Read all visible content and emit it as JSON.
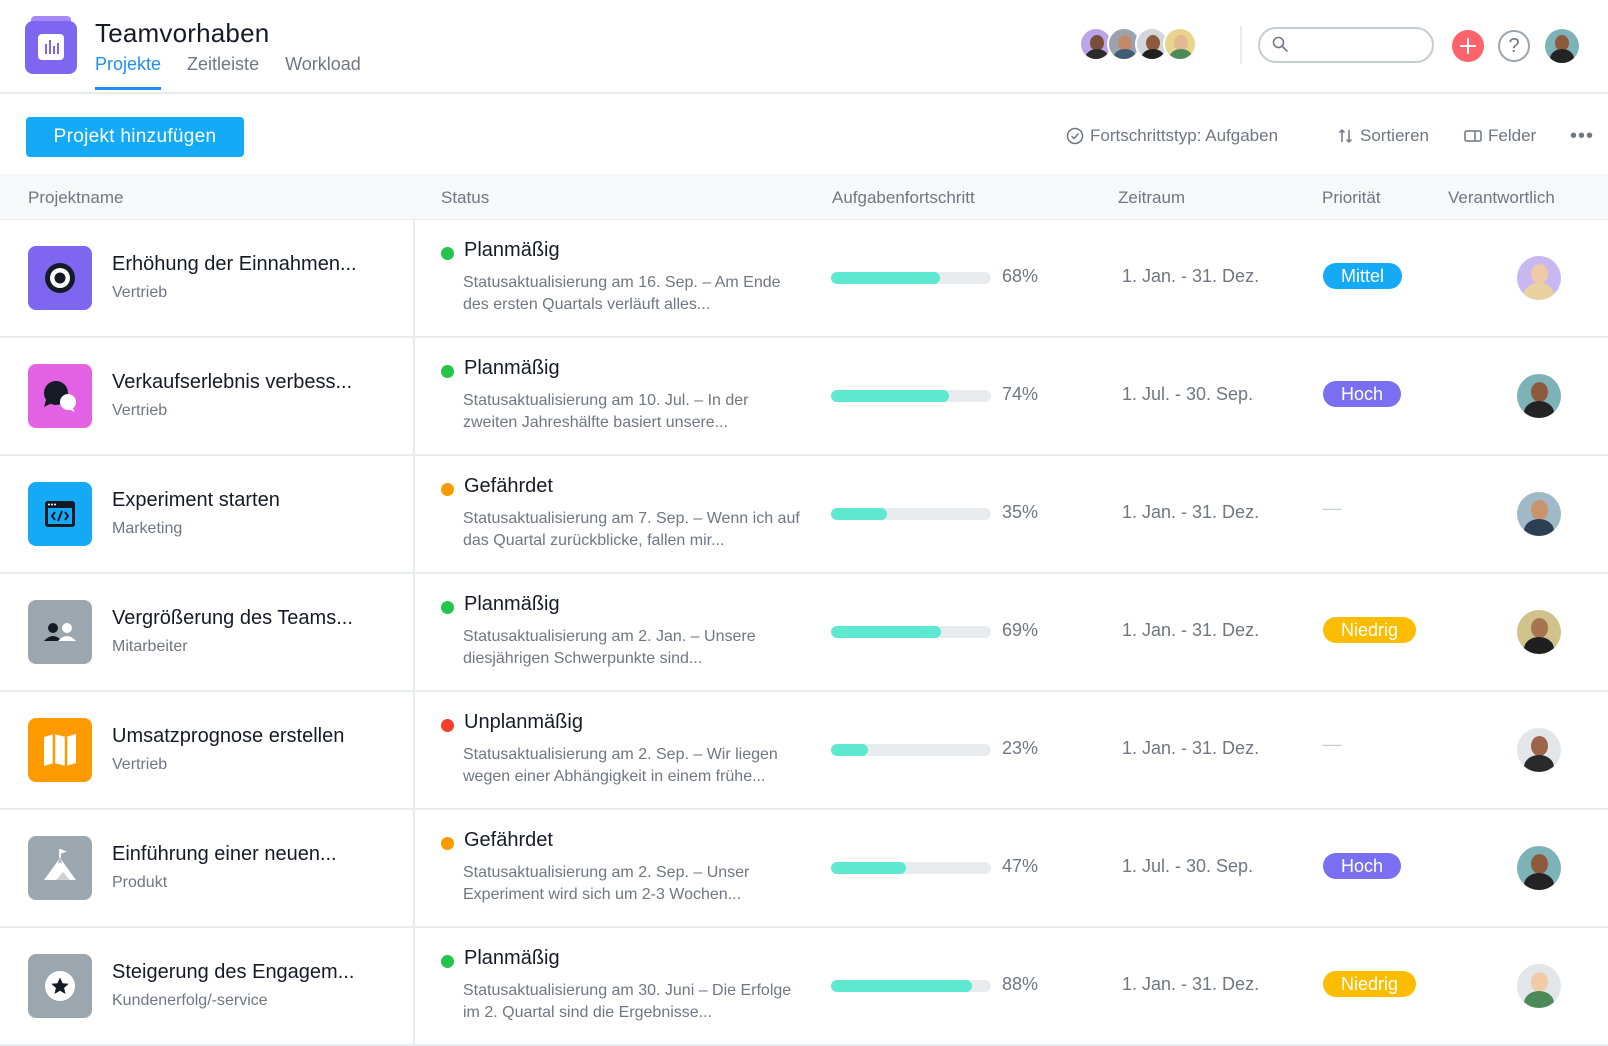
{
  "header": {
    "title": "Teamvorhaben",
    "tabs": [
      {
        "label": "Projekte",
        "active": true
      },
      {
        "label": "Zeitleiste",
        "active": false
      },
      {
        "label": "Workload",
        "active": false
      }
    ],
    "search": {
      "placeholder": "",
      "value": ""
    },
    "help_label": "?"
  },
  "toolbar": {
    "add_project_label": "Projekt hinzufügen",
    "progress_type_label": "Fortschrittstyp: Aufgaben",
    "sort_label": "Sortieren",
    "fields_label": "Felder",
    "more_label": "•••"
  },
  "table": {
    "columns": [
      "Projektname",
      "Status",
      "Aufgabenfortschritt",
      "Zeitraum",
      "Priorität",
      "Verantwortlich"
    ],
    "rows": [
      {
        "name": "Erhöhung der Einnahmen...",
        "team": "Vertrieb",
        "status": "Planmäßig",
        "status_color": "#25c44a",
        "desc": "Statusaktualisierung am 16. Sep. – Am Ende des ersten Quartals verläuft alles...",
        "progress_text": "68%",
        "progress": 0.68,
        "range": "1. Jan. - 31. Dez.",
        "priority": "Mittel",
        "priority_color": "#14aaf5",
        "icon": "target-icon",
        "icon_color": "#7f66f0"
      },
      {
        "name": "Verkaufserlebnis verbess...",
        "team": "Vertrieb",
        "status": "Planmäßig",
        "status_color": "#25c44a",
        "desc": "Statusaktualisierung am 10. Jul. – In der zweiten Jahreshälfte basiert unsere...",
        "progress_text": "74%",
        "progress": 0.74,
        "range": "1. Jul. - 30. Sep.",
        "priority": "Hoch",
        "priority_color": "#7a6ff0",
        "icon": "chat-bubbles-icon",
        "icon_color": "#e362e3"
      },
      {
        "name": "Experiment starten",
        "team": "Marketing",
        "status": "Gefährdet",
        "status_color": "#fd9a00",
        "desc": "Statusaktualisierung am 7. Sep. – Wenn ich auf das Quartal zurückblicke, fallen mir...",
        "progress_text": "35%",
        "progress": 0.35,
        "range": "1. Jan. - 31. Dez.",
        "priority": "",
        "priority_empty": "—",
        "icon": "code-window-icon",
        "icon_color": "#14aaf5"
      },
      {
        "name": "Vergrößerung des Teams...",
        "team": "Mitarbeiter",
        "status": "Planmäßig",
        "status_color": "#25c44a",
        "desc": "Statusaktualisierung am 2. Jan. – Unsere diesjährigen Schwerpunkte sind...",
        "progress_text": "69%",
        "progress": 0.69,
        "range": "1. Jan. - 31. Dez.",
        "priority": "Niedrig",
        "priority_color": "#fcbd01",
        "icon": "people-icon",
        "icon_color": "#9ca6af"
      },
      {
        "name": "Umsatzprognose erstellen",
        "team": "Vertrieb",
        "status": "Unplanmäßig",
        "status_color": "#f53d2b",
        "desc": "Statusaktualisierung am 2. Sep. – Wir liegen wegen einer Abhängigkeit in einem frühe...",
        "progress_text": "23%",
        "progress": 0.23,
        "range": "1. Jan. - 31. Dez.",
        "priority": "",
        "priority_empty": "—",
        "icon": "map-icon",
        "icon_color": "#fd9a00"
      },
      {
        "name": "Einführung einer neuen...",
        "team": "Produkt",
        "status": "Gefährdet",
        "status_color": "#fd9a00",
        "desc": "Statusaktualisierung am 2. Sep. – Unser Experiment wird sich um 2-3 Wochen...",
        "progress_text": "47%",
        "progress": 0.47,
        "range": "1. Jul. - 30. Sep.",
        "priority": "Hoch",
        "priority_color": "#7a6ff0",
        "icon": "mountain-flag-icon",
        "icon_color": "#9ca6af"
      },
      {
        "name": "Steigerung des Engagem...",
        "team": "Kundenerfolg/-service",
        "status": "Planmäßig",
        "status_color": "#25c44a",
        "desc": "Statusaktualisierung am 30. Juni – Die Erfolge im 2. Quartal sind die Ergebnisse...",
        "progress_text": "88%",
        "progress": 0.88,
        "range": "1. Jan. - 31. Dez.",
        "priority": "Niedrig",
        "priority_color": "#fcbd01",
        "icon": "star-icon",
        "icon_color": "#9ca6af"
      }
    ]
  },
  "colors": {
    "accent": "#1e8ef2",
    "button": "#14aaf5",
    "progress": "#5ce8d1",
    "plus": "#fc636b"
  }
}
